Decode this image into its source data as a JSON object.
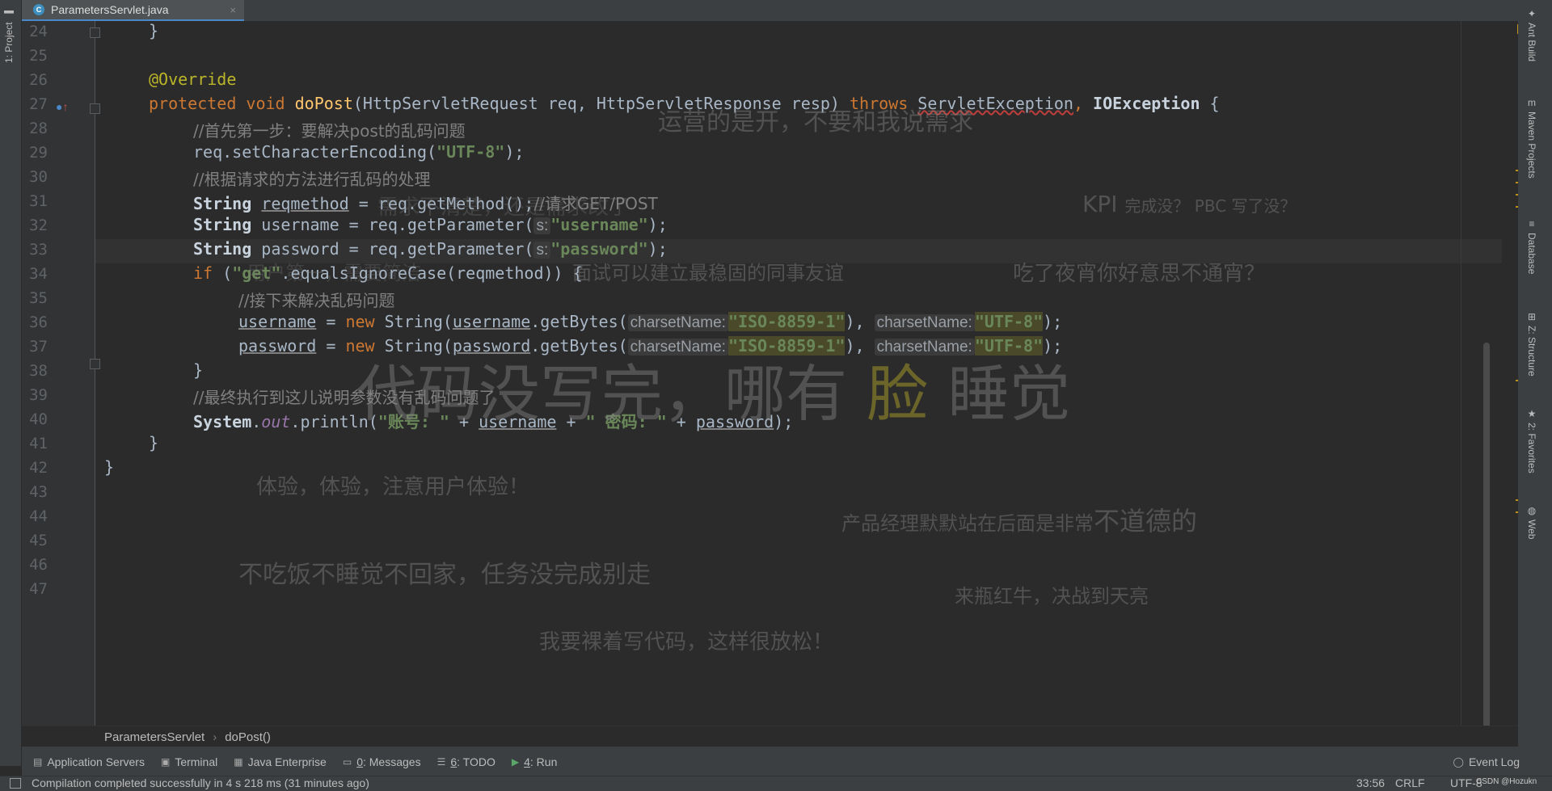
{
  "tab": {
    "label": "ParametersServlet.java",
    "close": "×",
    "icon_letter": "C"
  },
  "left_stripe": {
    "project_label": "1: Project"
  },
  "right_stripe": [
    "Ant Build",
    "Maven Projects",
    "Database",
    "Z: Structure",
    "2: Favorites",
    "Web"
  ],
  "line_numbers": [
    "24",
    "25",
    "26",
    "27",
    "28",
    "29",
    "30",
    "31",
    "32",
    "33",
    "34",
    "35",
    "36",
    "37",
    "38",
    "39",
    "40",
    "41",
    "42",
    "43",
    "44",
    "45",
    "46",
    "47"
  ],
  "code": {
    "l24": "}",
    "l26_ann": "@Override",
    "l27": {
      "kw1": "protected",
      "kw2": "void",
      "fn": "doPost",
      "p1": "(HttpServletRequest req, HttpServletResponse resp) ",
      "kw3": "throws",
      "ex1": "ServletException",
      "sep": ", ",
      "ex2": "IOException",
      "end": " {"
    },
    "l28": "//首先第一步：要解决post的乱码问题",
    "l29": {
      "pre": "req.setCharacterEncoding(",
      "str": "\"UTF-8\"",
      "post": ");"
    },
    "l30": "//根据请求的方法进行乱码的处理",
    "l31": {
      "type": "String",
      "var": "reqmethod",
      "mid": " = req.getMethod();",
      "cm": "//请求GET/POST"
    },
    "l32": {
      "type": "String",
      "var": " username = req.getParameter(",
      "hint": "s:",
      "str": "\"username\"",
      "post": ");"
    },
    "l33": {
      "type": "String",
      "var": " password = req.getParameter(",
      "hint": "s:",
      "str": "\"password\"",
      "post": ");"
    },
    "l34": {
      "kw": "if",
      "p": " (",
      "str": "\"get\"",
      "post": ".equalsIgnoreCase(reqmethod)) {"
    },
    "l35": "//接下来解决乱码问题",
    "l36": {
      "var": "username",
      "eq": " = ",
      "kw": "new",
      "mid": " String(",
      "var2": "username",
      "call": ".getBytes(",
      "hint1": "charsetName:",
      "str1": "\"ISO-8859-1\"",
      "sep": "), ",
      "hint2": "charsetName:",
      "str2": "\"UTF-8\"",
      "end": ");"
    },
    "l37": {
      "var": "password",
      "eq": " = ",
      "kw": "new",
      "mid": " String(",
      "var2": "password",
      "call": ".getBytes(",
      "hint1": "charsetName:",
      "str1": "\"ISO-8859-1\"",
      "sep": "), ",
      "hint2": "charsetName:",
      "str2": "\"UTF-8\"",
      "end": ");"
    },
    "l38": "}",
    "l39": "//最终执行到这儿说明参数没有乱码问题了",
    "l40": {
      "sys": "System",
      "dot": ".",
      "out": "out",
      "call": ".println(",
      "str1": "\"账号: \"",
      "plus1": " + ",
      "v1": "username",
      "plus2": " + ",
      "str2": "\" 密码: \"",
      "plus3": " + ",
      "v2": "password",
      "end": ");"
    },
    "l41": "}",
    "l42": "}"
  },
  "watermark": {
    "w1": "运营的是开，不要和我说需求",
    "w2": "KPI",
    "w2b": "完成没？ PBC 写了没？",
    "w3": "需求不清楚，还是需求改了",
    "w4": "吃了夜宵你好意思不通宵？",
    "w5": "用户第一，需要简洁",
    "w6": "面试可以建立最稳固的同事友谊",
    "w7a": "代码没写完，哪有",
    "w7b": "脸",
    "w7c": "睡觉",
    "w8": "体验，体验，注意用户体验！",
    "w9a": "产品经理默默站在后面是非常",
    "w9b": "不道德的",
    "w10": "不吃饭不睡觉不回家，任务没完成别走",
    "w11": "来瓶红牛，决战到天亮",
    "w12": "我要裸着写代码，这样很放松！"
  },
  "breadcrumb": {
    "class": "ParametersServlet",
    "method": "doPost()"
  },
  "toolbar": [
    {
      "key": "",
      "label": "Application Servers"
    },
    {
      "key": "",
      "label": "Terminal"
    },
    {
      "key": "",
      "label": "Java Enterprise"
    },
    {
      "key": "0",
      "label": ": Messages"
    },
    {
      "key": "6",
      "label": ": TODO"
    },
    {
      "key": "4",
      "label": ": Run"
    }
  ],
  "event_log": "Event Log",
  "status": {
    "message": "Compilation completed successfully in 4 s 218 ms (31 minutes ago)",
    "position": "33:56",
    "line_sep": "CRLF",
    "encoding": "UTF-8",
    "credit": "CSDN @Hozukn"
  }
}
